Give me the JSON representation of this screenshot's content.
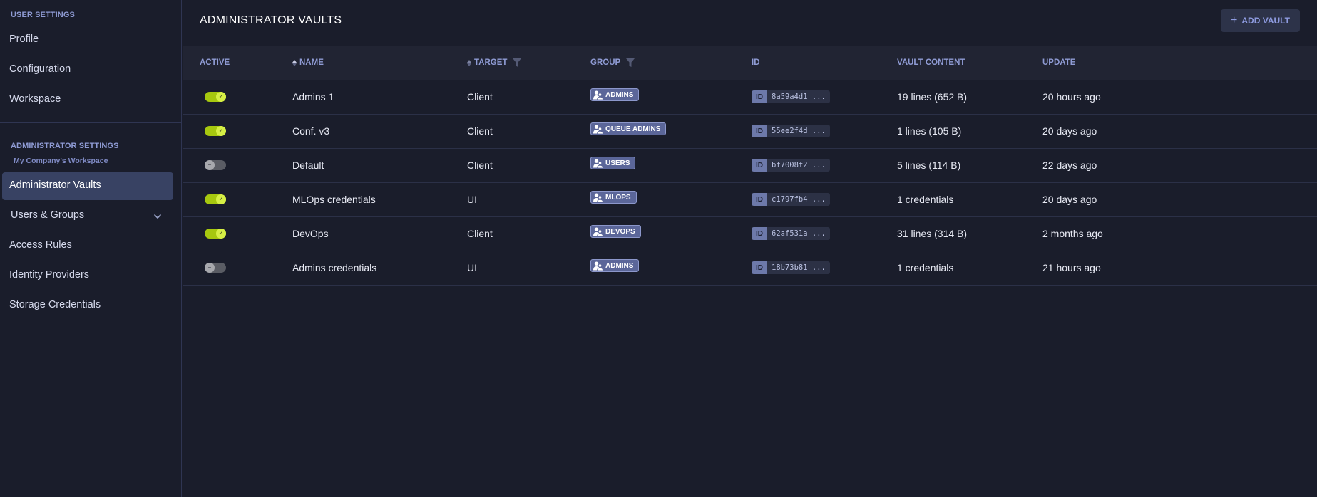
{
  "sidebar": {
    "user_settings_label": "USER SETTINGS",
    "user_items": [
      "Profile",
      "Configuration",
      "Workspace"
    ],
    "admin_settings_label": "ADMINISTRATOR SETTINGS",
    "workspace_name": "My Company's Workspace",
    "active_item": "Administrator Vaults",
    "admin_items": [
      "Users & Groups",
      "Access Rules",
      "Identity Providers",
      "Storage Credentials"
    ]
  },
  "main": {
    "title": "ADMINISTRATOR VAULTS",
    "add_button_label": "ADD VAULT",
    "add_button_icon": "+",
    "columns": {
      "active": "ACTIVE",
      "name": "NAME",
      "target": "TARGET",
      "group": "GROUP",
      "id": "ID",
      "vault_content": "VAULT CONTENT",
      "update": "UPDATE"
    },
    "id_label": "ID",
    "rows": [
      {
        "active": true,
        "name": "Admins 1",
        "target": "Client",
        "group": "ADMINS",
        "id": "8a59a4d1 ...",
        "content": "19 lines (652 B)",
        "update": "20 hours ago"
      },
      {
        "active": true,
        "name": "Conf. v3",
        "target": "Client",
        "group": "QUEUE ADMINS",
        "id": "55ee2f4d ...",
        "content": "1 lines (105 B)",
        "update": "20 days ago"
      },
      {
        "active": false,
        "name": "Default",
        "target": "Client",
        "group": "USERS",
        "id": "bf7008f2 ...",
        "content": "5 lines (114 B)",
        "update": "22 days ago"
      },
      {
        "active": true,
        "name": "MLOps credentials",
        "target": "UI",
        "group": "MLOPS",
        "id": "c1797fb4 ...",
        "content": "1 credentials",
        "update": "20 days ago"
      },
      {
        "active": true,
        "name": "DevOps",
        "target": "Client",
        "group": "DEVOPS",
        "id": "62af531a ...",
        "content": "31 lines (314 B)",
        "update": "2 months ago"
      },
      {
        "active": false,
        "name": "Admins credentials",
        "target": "UI",
        "group": "ADMINS",
        "id": "18b73b81 ...",
        "content": "1 credentials",
        "update": "21 hours ago"
      }
    ]
  },
  "colors": {
    "background": "#1a1d2b",
    "accent": "#8f9bd4",
    "toggle_on": "#a7c80f",
    "toggle_off": "#5a5c64",
    "active_nav": "#384263"
  }
}
